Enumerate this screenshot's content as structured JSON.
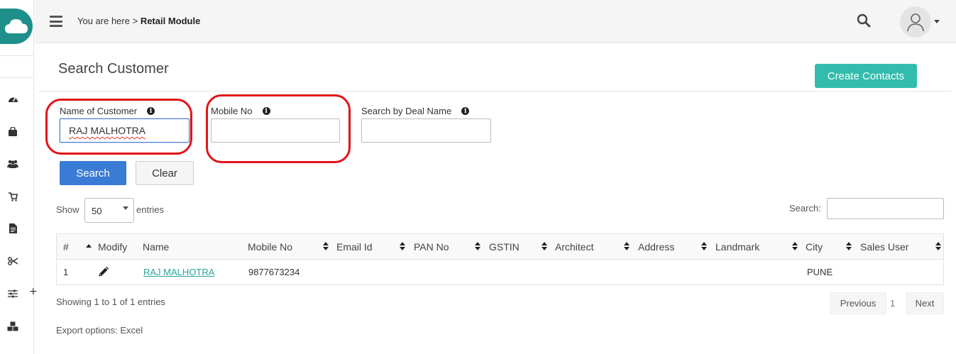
{
  "breadcrumb": {
    "prefix": "You are here >",
    "current": "Retail Module"
  },
  "page": {
    "title": "Search Customer",
    "create_button": "Create Contacts"
  },
  "form": {
    "customer_name": {
      "label": "Name of Customer",
      "value": "RAJ MALHOTRA"
    },
    "mobile": {
      "label": "Mobile No",
      "value": ""
    },
    "deal_name": {
      "label": "Search by Deal Name",
      "value": ""
    },
    "search_button": "Search",
    "clear_button": "Clear"
  },
  "length_control": {
    "show": "Show",
    "value": "50",
    "entries": "entries"
  },
  "table_search": {
    "label": "Search:",
    "value": ""
  },
  "table": {
    "columns": [
      "#",
      "Modify",
      "Name",
      "Mobile No",
      "Email Id",
      "PAN No",
      "GSTIN",
      "Architect",
      "Address",
      "Landmark",
      "City",
      "Sales User"
    ],
    "rows": [
      {
        "index": "1",
        "name": "RAJ MALHOTRA",
        "mobile": "9877673234",
        "email": "",
        "pan": "",
        "gstin": "",
        "architect": "",
        "address": "",
        "landmark": "",
        "city": "PUNE",
        "sales_user": ""
      }
    ]
  },
  "footer": {
    "info": "Showing 1 to 1 of 1 entries",
    "previous": "Previous",
    "current_page": "1",
    "next": "Next",
    "export": "Export options: Excel"
  },
  "colors": {
    "accent": "#32bcad",
    "primary": "#3a7bd5",
    "link": "#2aa59a",
    "highlight": "#e0151b"
  }
}
